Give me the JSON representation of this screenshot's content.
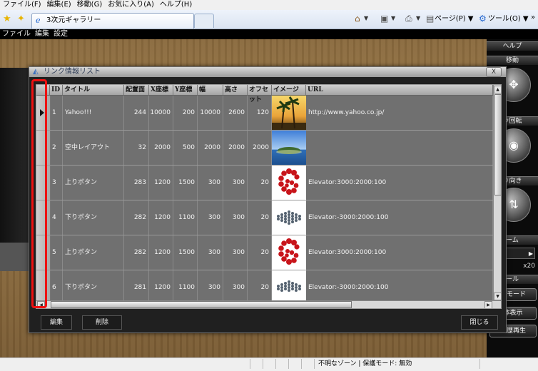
{
  "browser": {
    "menu": [
      "ファイル(F)",
      "編集(E)",
      "移動(G)",
      "お気に入り(A)",
      "ヘルプ(H)"
    ],
    "tab_title": "3次元ギャラリー",
    "page_menu": "ページ(P) ▼",
    "tools_menu": "ツール(O) ▼",
    "overflow": "»"
  },
  "app_menu": [
    "ファイル",
    "編集",
    "設定"
  ],
  "right_panel": {
    "help": "ヘルプ",
    "move": "移動",
    "rotate": "ラ回転",
    "direction": "り向き",
    "zoom": "ーム",
    "zoom_value": "x20",
    "tool": "ール",
    "mode_button": "食モード",
    "display_button": "体表示",
    "history_button": "履歴再生"
  },
  "dialog": {
    "title": "リンク情報リスト",
    "close": "X",
    "columns": [
      "ID",
      "タイトル",
      "配置面",
      "X座標",
      "Y座標",
      "幅",
      "高さ",
      "オフセット",
      "イメージ",
      "URL"
    ],
    "rows": [
      {
        "id": "1",
        "title": "Yahoo!!!",
        "face": "244",
        "x": "10000",
        "y": "200",
        "width": "10000",
        "height": "2600",
        "offset": "120",
        "image": "palm-trees",
        "url": "http://www.yahoo.co.jp/",
        "selected": true
      },
      {
        "id": "2",
        "title": "空中レイアウト",
        "face": "32",
        "x": "2000",
        "y": "500",
        "width": "2000",
        "height": "2000",
        "offset": "2000",
        "image": "island",
        "url": "",
        "selected": false
      },
      {
        "id": "3",
        "title": "上りボタン",
        "face": "283",
        "x": "1200",
        "y": "1500",
        "width": "300",
        "height": "300",
        "offset": "20",
        "image": "red-spiral",
        "url": "Elevator:3000:2000:100",
        "selected": false
      },
      {
        "id": "4",
        "title": "下りボタン",
        "face": "282",
        "x": "1200",
        "y": "1100",
        "width": "300",
        "height": "300",
        "offset": "20",
        "image": "sphere-grid",
        "url": "Elevator:-3000:2000:100",
        "selected": false
      },
      {
        "id": "5",
        "title": "上りボタン",
        "face": "282",
        "x": "1200",
        "y": "1500",
        "width": "300",
        "height": "300",
        "offset": "20",
        "image": "red-spiral",
        "url": "Elevator:3000:2000:100",
        "selected": false
      },
      {
        "id": "6",
        "title": "下りボタン",
        "face": "281",
        "x": "1200",
        "y": "1100",
        "width": "300",
        "height": "300",
        "offset": "20",
        "image": "sphere-grid",
        "url": "Elevator:-3000:2000:100",
        "selected": false
      }
    ],
    "edit_button": "編集",
    "delete_button": "削除",
    "close_button": "閉じる"
  },
  "status_bar": {
    "text": "不明なゾーン | 保護モード: 無効"
  },
  "colors": {
    "highlight": "#e11111",
    "scene_floor": "#8c6c3f",
    "dialog_bg": "#202020"
  }
}
